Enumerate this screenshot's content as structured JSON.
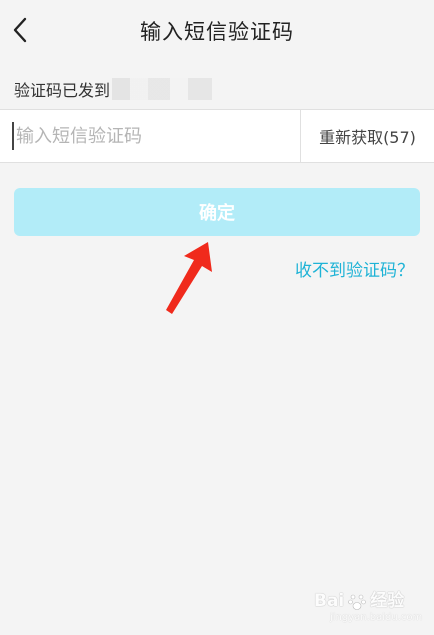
{
  "header": {
    "title": "输入短信验证码"
  },
  "notice": {
    "text": "验证码已发到"
  },
  "input": {
    "placeholder": "输入短信验证码",
    "value": ""
  },
  "resend": {
    "label": "重新获取(57)"
  },
  "confirm": {
    "label": "确定"
  },
  "help": {
    "label": "收不到验证码？"
  },
  "watermark": {
    "brand": "Bai",
    "brand_tail": "经验",
    "url": "jingyan.baidu.com"
  },
  "colors": {
    "accent": "#1fb3d6",
    "button_disabled": "#b2ecf8",
    "arrow": "#f02a1c",
    "background": "#f4f4f4"
  },
  "icons": {
    "back": "chevron-left-icon",
    "annotation": "red-arrow-icon",
    "watermark": "paw-icon"
  }
}
